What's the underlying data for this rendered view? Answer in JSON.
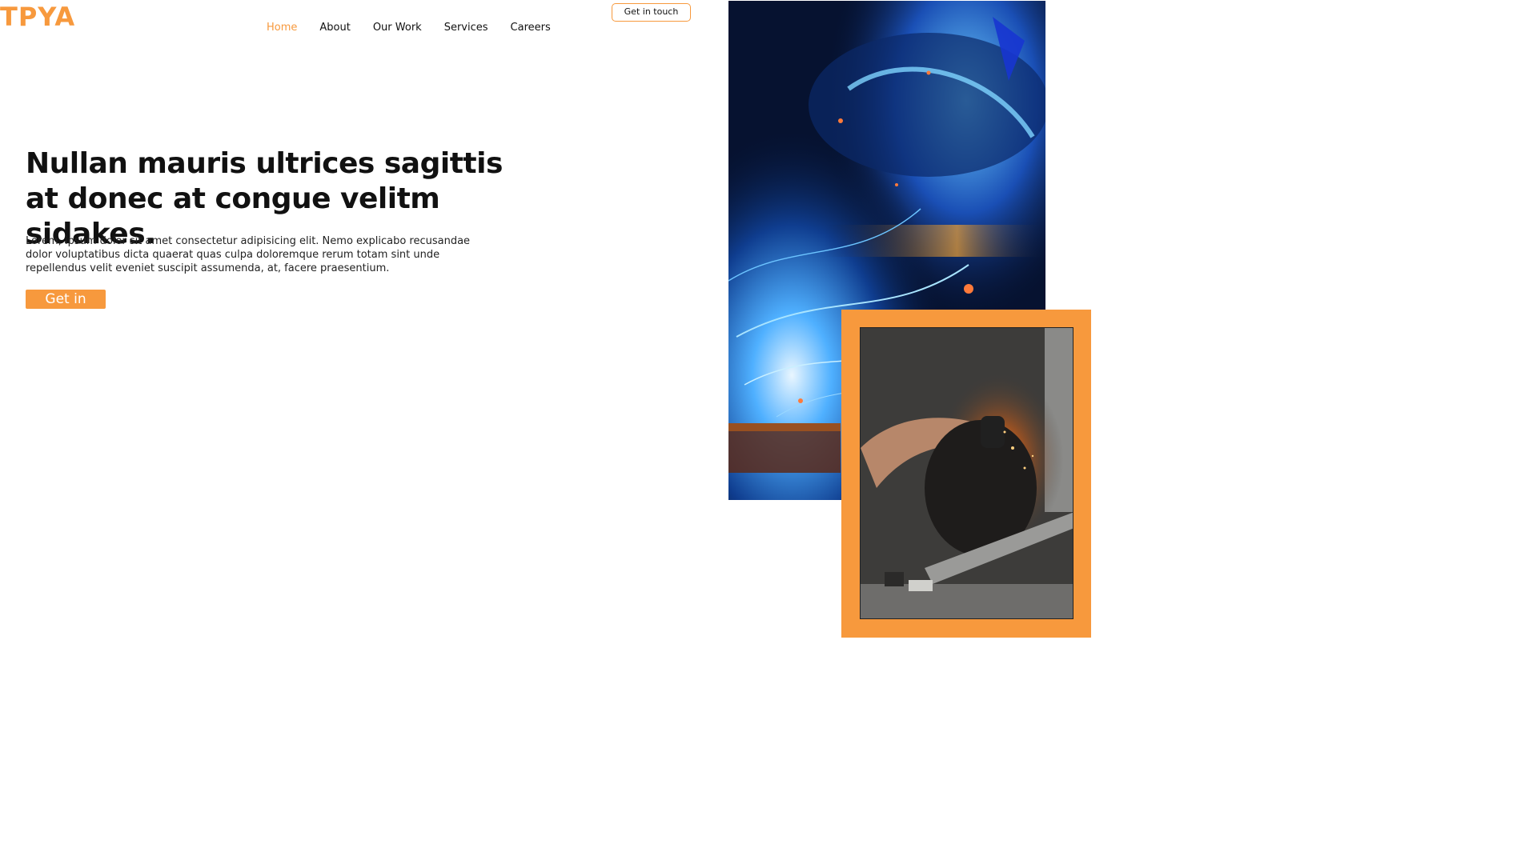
{
  "brand": {
    "logo_text": "TPYA",
    "accent_color": "#f7993d"
  },
  "nav": {
    "items": [
      {
        "label": "Home",
        "active": true
      },
      {
        "label": "About",
        "active": false
      },
      {
        "label": "Our Work",
        "active": false
      },
      {
        "label": "Services",
        "active": false
      },
      {
        "label": "Careers",
        "active": false
      }
    ],
    "cta_label": "Get in touch"
  },
  "hero": {
    "headline": "Nullan mauris ultrices sagittis at donec at congue velitm sidakes.",
    "body": "Lorem, ipsum dolor sit amet consectetur adipisicing elit. Nemo explicabo recusandae dolor voluptatibus dicta quaerat quas culpa doloremque rerum totam sint unde repellendus velit eveniet suscipit assumenda, at, facere praesentium.",
    "button_label": "Get in"
  },
  "images": {
    "primary_icon": "welder-photo",
    "secondary_icon": "grinder-photo",
    "frame_color": "#f7993d"
  }
}
